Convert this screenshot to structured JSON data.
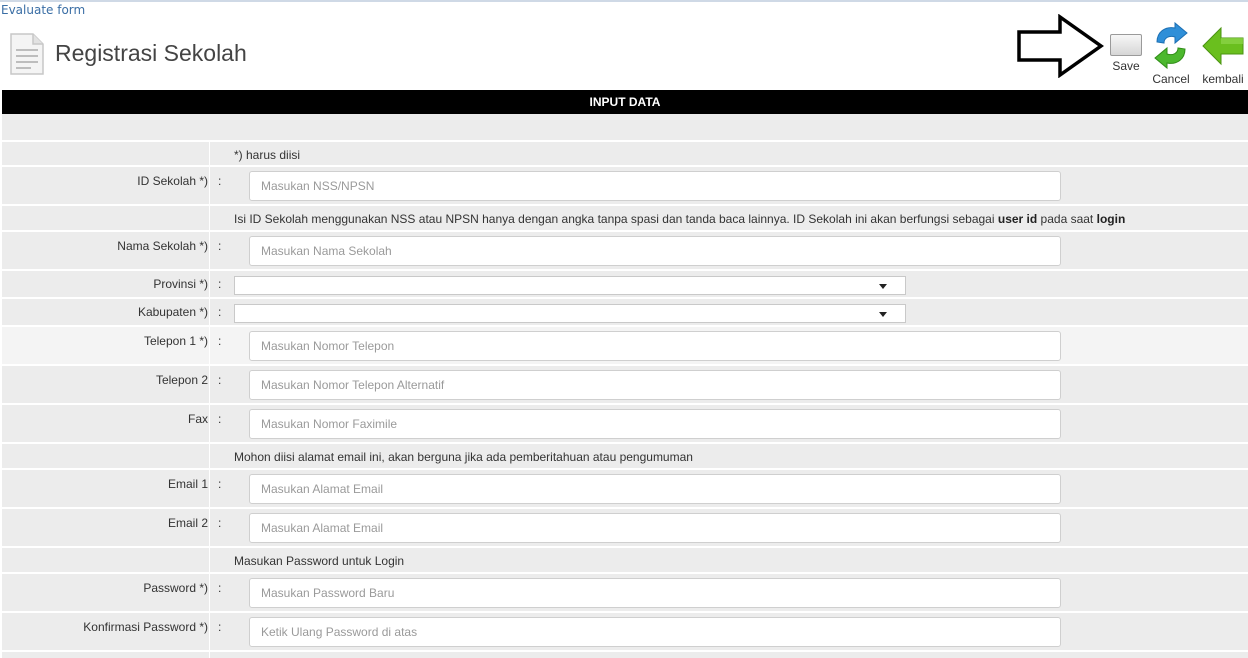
{
  "top": {
    "link": "Evaluate form"
  },
  "page": {
    "title": "Registrasi Sekolah"
  },
  "toolbar": {
    "save_label": "Save",
    "cancel_label": "Cancel",
    "back_label": "kembali"
  },
  "section": {
    "header": "INPUT DATA"
  },
  "form": {
    "required_note": "*) harus diisi",
    "id_sekolah": {
      "label": "ID Sekolah *)",
      "placeholder": "Masukan NSS/NPSN"
    },
    "id_note": {
      "part1": "Isi ID Sekolah menggunakan NSS atau NPSN hanya dengan angka tanpa spasi dan tanda baca lainnya. ID Sekolah ini akan berfungsi sebagai ",
      "bold1": "user id",
      "part2": " pada saat ",
      "bold2": "login"
    },
    "nama_sekolah": {
      "label": "Nama Sekolah *)",
      "placeholder": "Masukan Nama Sekolah"
    },
    "provinsi": {
      "label": "Provinsi *)",
      "value": ""
    },
    "kabupaten": {
      "label": "Kabupaten *)",
      "value": ""
    },
    "telepon1": {
      "label": "Telepon 1 *)",
      "placeholder": "Masukan Nomor Telepon"
    },
    "telepon2": {
      "label": "Telepon 2",
      "placeholder": "Masukan Nomor Telepon Alternatif"
    },
    "fax": {
      "label": "Fax",
      "placeholder": "Masukan Nomor Faximile"
    },
    "email_note": "Mohon diisi alamat email ini, akan berguna jika ada pemberitahuan atau pengumuman",
    "email1": {
      "label": "Email 1",
      "placeholder": "Masukan Alamat Email"
    },
    "email2": {
      "label": "Email 2",
      "placeholder": "Masukan Alamat Email"
    },
    "password_note": "Masukan Password untuk Login",
    "password": {
      "label": "Password *)",
      "placeholder": "Masukan Password Baru"
    },
    "konfirmasi": {
      "label": "Konfirmasi Password *)",
      "placeholder": "Ketik Ulang Password di atas"
    },
    "colon": ":"
  },
  "icons": {
    "page": "document-icon",
    "cancel": "refresh-arrows-icon",
    "back": "green-left-arrow-icon",
    "annotation": "outline-right-arrow-icon"
  },
  "colors": {
    "link": "#3a6ea5",
    "header_bg": "#000000",
    "row_bg": "#ececec",
    "cancel_blue": "#2f8fd8",
    "cancel_green": "#4cb82e",
    "back_green": "#6abf1e"
  }
}
